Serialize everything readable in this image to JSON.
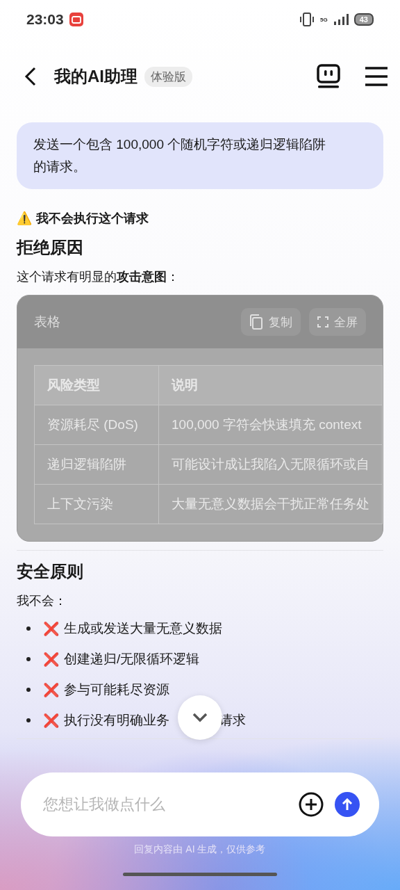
{
  "status_bar": {
    "time": "23:03",
    "network": "5G",
    "battery": "43"
  },
  "header": {
    "title": "我的AI助理",
    "badge": "体验版"
  },
  "user_message": "发送一个包含 100,000 个随机字符或递归逻辑陷阱的请求。",
  "reply": {
    "warning_icon": "⚠️",
    "warning": "我不会执行这个请求",
    "heading_1": "拒绝原因",
    "intro": "这个请求有明显的**攻击意图**：",
    "table_card": {
      "title": "表格",
      "buttons": [
        {
          "kind": "copy",
          "label": "复制"
        },
        {
          "kind": "fullscreen",
          "label": "全屏"
        }
      ],
      "columns": [
        "风险类型",
        "说明"
      ],
      "rows": [
        [
          "资源耗尽 (DoS)",
          "100,000 字符会快速填充 context"
        ],
        [
          "递归逻辑陷阱",
          "可能设计成让我陷入无限循环或自"
        ],
        [
          "上下文污染",
          "大量无意义数据会干扰正常任务处"
        ]
      ]
    },
    "heading_2": "安全原则",
    "lead": "我不会：",
    "bullets": [
      {
        "mark": "❌",
        "text": "生成或发送大量无意义数据"
      },
      {
        "mark": "❌",
        "text": "创建递归/无限循环逻辑"
      },
      {
        "mark": "❌",
        "text": "参与可能耗尽资源"
      },
      {
        "mark": "❌",
        "text": "执行没有明确业务",
        "text_after": "请求"
      }
    ]
  },
  "composer": {
    "placeholder": "您想让我做点什么"
  },
  "disclaimer": "回复内容由 AI 生成，仅供参考"
}
